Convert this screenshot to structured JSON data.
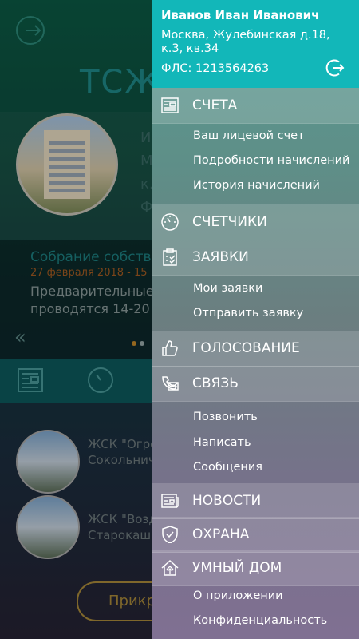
{
  "background": {
    "title": "ТСЖ",
    "card_lines": [
      "И",
      "М",
      "к.",
      "Ф"
    ],
    "news": {
      "title": "Собрание собств",
      "date": "27 февраля 2018 - 15",
      "body_lines": [
        "Предварительные с",
        "проводятся 14-20"
      ]
    },
    "list": [
      {
        "name": "ЖСК \"Огро",
        "address": "Сокольнич"
      },
      {
        "name": "ЖСК \"Возд",
        "address": "Старокаши"
      }
    ],
    "button_label": "Прикр"
  },
  "user": {
    "name": "Иванов Иван Иванович",
    "address": "Москва, Жулебинская д.18, к.3, кв.34",
    "account": "ФЛС: 1213564263"
  },
  "menu": {
    "accounts": {
      "label": "СЧЕТА",
      "icon": "document-icon",
      "items": [
        "Ваш лицевой счет",
        "Подробности начислений",
        "История начислений"
      ]
    },
    "meters": {
      "label": "СЧЕТЧИКИ",
      "icon": "gauge-icon"
    },
    "requests": {
      "label": "ЗАЯВКИ",
      "icon": "clipboard-check-icon",
      "items": [
        "Мои заявки",
        "Отправить заявку"
      ]
    },
    "voting": {
      "label": "ГОЛОСОВАНИЕ",
      "icon": "thumbs-up-icon"
    },
    "contact": {
      "label": "СВЯЗЬ",
      "icon": "phone-mail-icon",
      "items": [
        "Позвонить",
        "Написать",
        "Сообщения"
      ]
    },
    "news": {
      "label": "НОВОСТИ",
      "icon": "newspaper-icon"
    },
    "security": {
      "label": "ОХРАНА",
      "icon": "shield-check-icon"
    },
    "smart_home": {
      "label": "УМНЫЙ ДОМ",
      "icon": "smart-home-icon",
      "items": [
        "О приложении",
        "Конфиденциальность"
      ]
    }
  },
  "colors": {
    "header": "#12b7b9",
    "accent_orange": "#a45b22",
    "accent_teal": "#1d7f80"
  }
}
